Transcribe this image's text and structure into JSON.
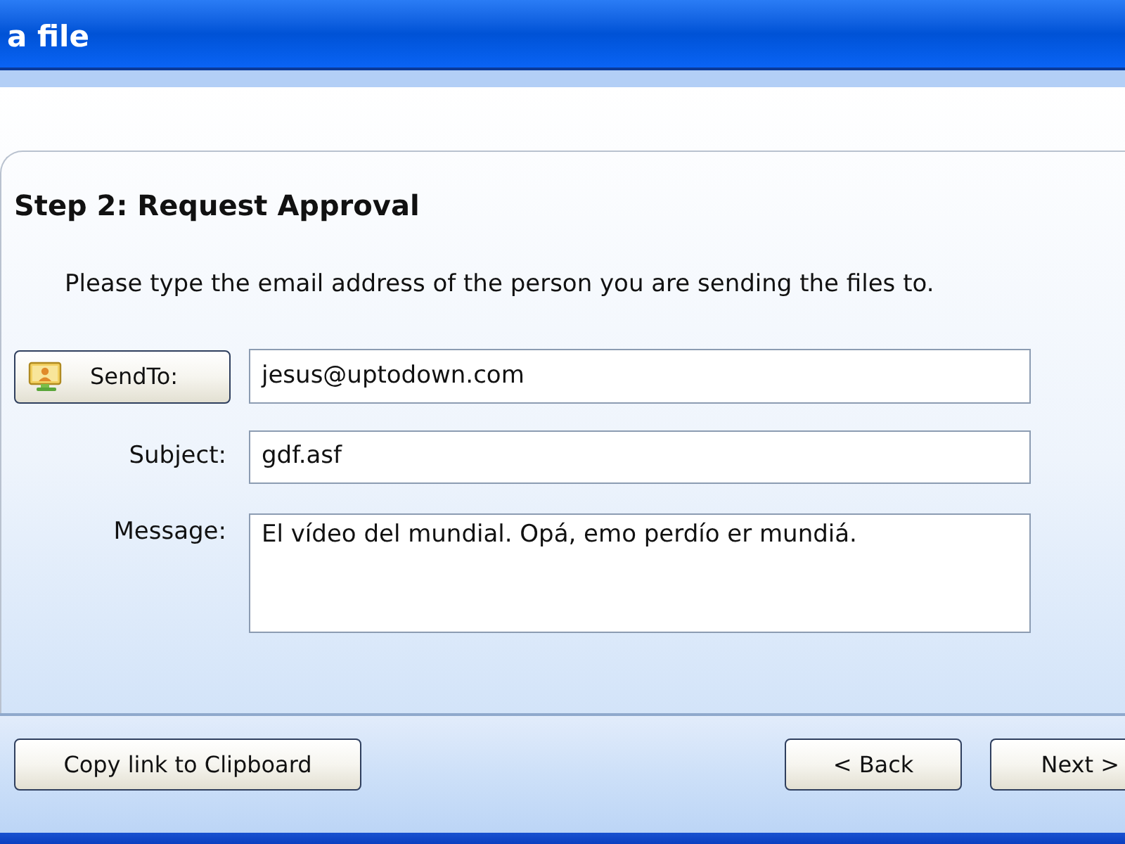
{
  "window": {
    "title": "a file"
  },
  "step": {
    "title": "Step 2: Request Approval",
    "instruction": "Please type the email address of the person you are sending the files to."
  },
  "form": {
    "send_to": {
      "button": "SendTo:",
      "value": "jesus@uptodown.com"
    },
    "subject": {
      "label": "Subject:",
      "value": "gdf.asf"
    },
    "message": {
      "label": "Message:",
      "value": "El vídeo del mundial. Opá, emo perdío er mundiá."
    }
  },
  "footer": {
    "copy_link": "Copy link to Clipboard",
    "back": "< Back",
    "next": "Next >"
  }
}
